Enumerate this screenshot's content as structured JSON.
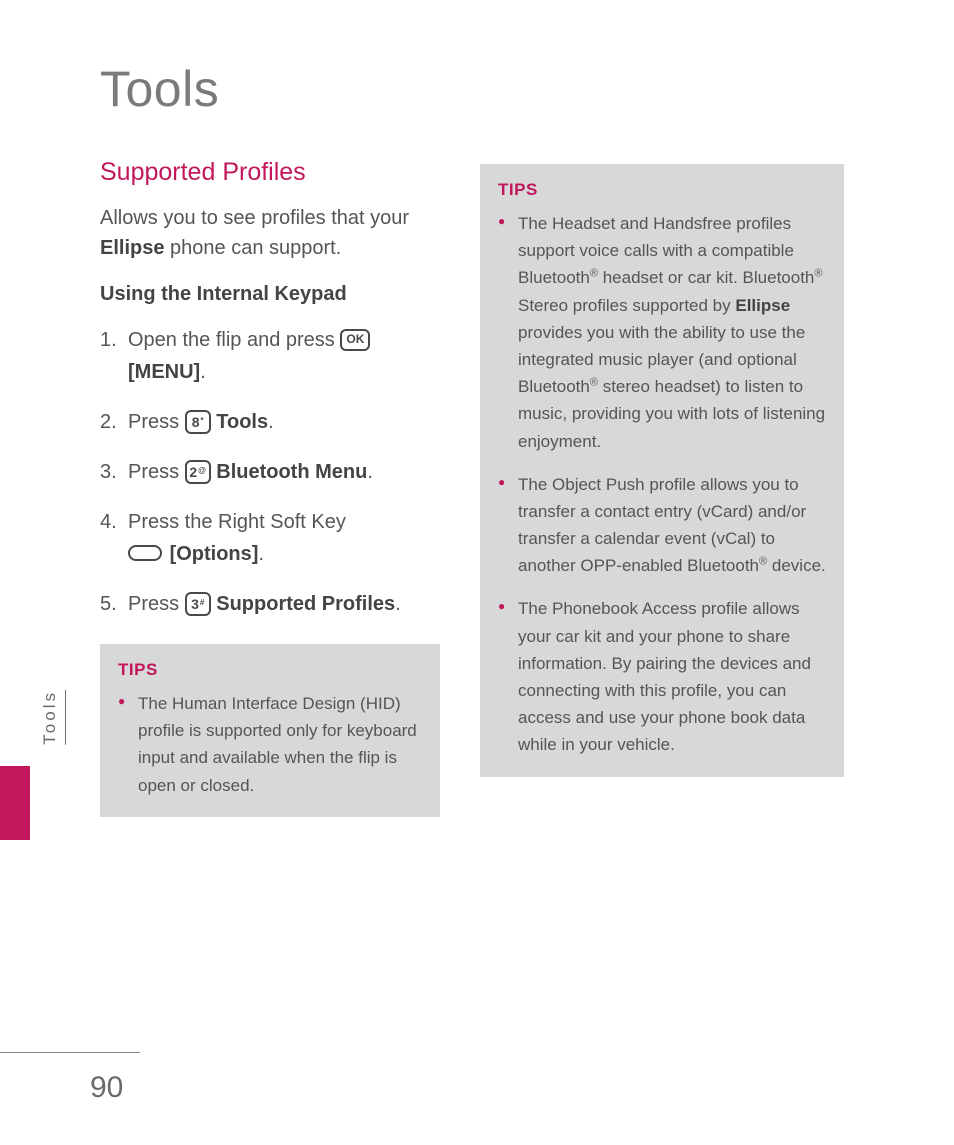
{
  "title": "Tools",
  "sidetab": "Tools",
  "pagenum": "90",
  "left": {
    "heading": "Supported Profiles",
    "intro_pre": "Allows you to see profiles that your ",
    "intro_bold": "Ellipse",
    "intro_post": " phone can support.",
    "sub_heading": "Using the Internal Keypad",
    "steps": {
      "s1_a": "Open the flip and press ",
      "s1_key": "OK",
      "s1_bold": "[MENU]",
      "s1_b": ".",
      "s2_a": "Press ",
      "s2_key": "8",
      "s2_keysup": "*",
      "s2_bold": "Tools",
      "s2_b": ".",
      "s3_a": "Press ",
      "s3_key": "2",
      "s3_keysup": "@",
      "s3_bold": "Bluetooth Menu",
      "s3_b": ".",
      "s4_a": "Press the Right Soft Key ",
      "s4_bold": "[Options]",
      "s4_b": ".",
      "s5_a": "Press ",
      "s5_key": "3",
      "s5_keysup": "#",
      "s5_bold": "Supported Profiles",
      "s5_b": "."
    },
    "tips_title": "TIPS",
    "tips": {
      "t1": "The Human Interface Design (HID) profile is supported only for keyboard input and available when the flip is open or closed."
    }
  },
  "right": {
    "tips_title": "TIPS",
    "tips": {
      "t1_a": "The Headset and Handsfree profiles support voice calls with a compatible Bluetooth",
      "t1_b": " headset or car kit. Bluetooth",
      "t1_c": " Stereo profiles supported by ",
      "t1_bold": "Ellipse",
      "t1_d": " provides you with the ability to use the integrated music player (and optional Bluetooth",
      "t1_e": " stereo headset) to listen to music, providing you with lots of listening enjoyment.",
      "t2_a": "The Object Push profile allows you to transfer a contact entry (vCard) and/or transfer a calendar event (vCal) to another OPP-enabled Bluetooth",
      "t2_b": " device.",
      "t3": "The Phonebook Access profile allows your car kit and your phone to share information. By pairing the devices and connecting with this profile, you can access and use your phone book data while in your vehicle."
    }
  }
}
